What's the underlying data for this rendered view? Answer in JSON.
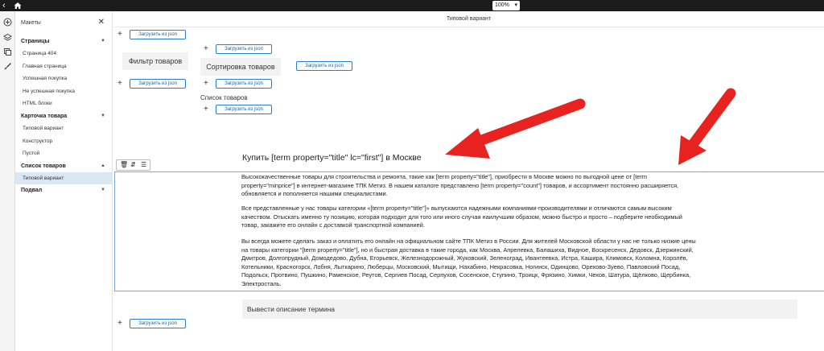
{
  "topbar": {
    "back_icon": "chevron-left-icon",
    "home_icon": "home-icon",
    "zoom_value": "100%"
  },
  "rail": {
    "icons": [
      "add-icon",
      "layers-icon",
      "copy-icon",
      "brush-icon"
    ]
  },
  "sidebar": {
    "title": "Макеты",
    "close": "✕",
    "sections": [
      {
        "label": "Страницы",
        "items": [
          "Страница 404",
          "Главная страница",
          "Успешная покупка",
          "Не успешная покупка",
          "HTML блоки"
        ]
      },
      {
        "label": "Карточка товара",
        "items": [
          "Типовой вариант",
          "Конструктор",
          "Пустой"
        ]
      },
      {
        "label": "Список товаров",
        "items": [
          "Типовой вариант"
        ]
      },
      {
        "label": "Подвал",
        "items": []
      }
    ]
  },
  "main": {
    "title": "Типовой вариант",
    "json_button_label": "Загрузить из json",
    "plus": "+",
    "filter_label": "Фильтр товаров",
    "sort_label": "Сортировка товаров",
    "list_label": "Список товаров",
    "heading": "Купить [term property=\"title\" lc=\"first\"]  в Москве",
    "paragraphs": [
      "Высококачественные товары для строительства и ремонта, такие как [term property=\"title\"], приобрести в Москве можно по выгодной цене от [term property=\"minprice\"] в интернет-магазине ТПК Метиз. В нашем каталоге представлено [term property=\"count\"] товаров, и ассортимент постоянно расширяется, обновляется и пополняется нашими специалистами.",
      "Все представленные у нас товары категории «[term property=\"title\"]» выпускаются надежными компаниями-производителями и отличаются самым высоким качеством. Отыскать именно ту позицию, которая подходит для того или иного случая наилучшим образом, можно быстро и просто – подберите необходимый товар, закажите его онлайн с доставкой транспортной компанией.",
      "Вы всегда можете сделать заказ и оплатить его онлайн на официальном сайте ТПК Метиз в России. Для жителей Московской области у нас не только низкие цены на товары категории \"[term property=\"title\"], но и быстрая доставка в такие города, как Москва, Апрелевка, Балашиха, Видное, Воскресенск, Дедовск, Дзержинский, Дмитров, Долгопрудный, Домодедово, Дубна, Егорьевск, Железнодорожный, Жуковский, Зеленоград, Ивантеевка, Истра, Кашира, Климовск, Коломна, Королёв, Котельники, Красногорск, Лобня, Лыткарино, Люберцы, Московский, Мытищи, Нахабино, Некрасовка, Ногинск, Одинцово, Орехово-Зуево, Павловский Посад, Подольск, Протвино, Пушкино, Раменское, Реутов, Сергиев Посад, Серпухов, Сосенское, Ступино, Троицк, Фрязино, Химки, Чехов, Шатура, Щёлково, Щербинка, Электросталь."
    ],
    "output_label": "Вывести описание термина",
    "toolbar_icons": [
      "trash-icon",
      "move-icon",
      "menu-icon"
    ],
    "accent_color": "#e8231f"
  }
}
